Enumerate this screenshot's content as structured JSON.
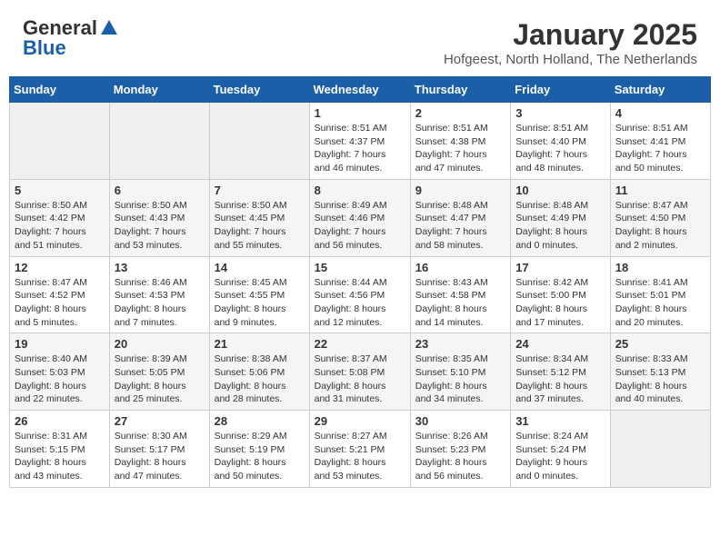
{
  "header": {
    "logo_general": "General",
    "logo_blue": "Blue",
    "month_year": "January 2025",
    "location": "Hofgeest, North Holland, The Netherlands"
  },
  "days_of_week": [
    "Sunday",
    "Monday",
    "Tuesday",
    "Wednesday",
    "Thursday",
    "Friday",
    "Saturday"
  ],
  "weeks": [
    [
      {
        "day": "",
        "info": ""
      },
      {
        "day": "",
        "info": ""
      },
      {
        "day": "",
        "info": ""
      },
      {
        "day": "1",
        "info": "Sunrise: 8:51 AM\nSunset: 4:37 PM\nDaylight: 7 hours and 46 minutes."
      },
      {
        "day": "2",
        "info": "Sunrise: 8:51 AM\nSunset: 4:38 PM\nDaylight: 7 hours and 47 minutes."
      },
      {
        "day": "3",
        "info": "Sunrise: 8:51 AM\nSunset: 4:40 PM\nDaylight: 7 hours and 48 minutes."
      },
      {
        "day": "4",
        "info": "Sunrise: 8:51 AM\nSunset: 4:41 PM\nDaylight: 7 hours and 50 minutes."
      }
    ],
    [
      {
        "day": "5",
        "info": "Sunrise: 8:50 AM\nSunset: 4:42 PM\nDaylight: 7 hours and 51 minutes."
      },
      {
        "day": "6",
        "info": "Sunrise: 8:50 AM\nSunset: 4:43 PM\nDaylight: 7 hours and 53 minutes."
      },
      {
        "day": "7",
        "info": "Sunrise: 8:50 AM\nSunset: 4:45 PM\nDaylight: 7 hours and 55 minutes."
      },
      {
        "day": "8",
        "info": "Sunrise: 8:49 AM\nSunset: 4:46 PM\nDaylight: 7 hours and 56 minutes."
      },
      {
        "day": "9",
        "info": "Sunrise: 8:48 AM\nSunset: 4:47 PM\nDaylight: 7 hours and 58 minutes."
      },
      {
        "day": "10",
        "info": "Sunrise: 8:48 AM\nSunset: 4:49 PM\nDaylight: 8 hours and 0 minutes."
      },
      {
        "day": "11",
        "info": "Sunrise: 8:47 AM\nSunset: 4:50 PM\nDaylight: 8 hours and 2 minutes."
      }
    ],
    [
      {
        "day": "12",
        "info": "Sunrise: 8:47 AM\nSunset: 4:52 PM\nDaylight: 8 hours and 5 minutes."
      },
      {
        "day": "13",
        "info": "Sunrise: 8:46 AM\nSunset: 4:53 PM\nDaylight: 8 hours and 7 minutes."
      },
      {
        "day": "14",
        "info": "Sunrise: 8:45 AM\nSunset: 4:55 PM\nDaylight: 8 hours and 9 minutes."
      },
      {
        "day": "15",
        "info": "Sunrise: 8:44 AM\nSunset: 4:56 PM\nDaylight: 8 hours and 12 minutes."
      },
      {
        "day": "16",
        "info": "Sunrise: 8:43 AM\nSunset: 4:58 PM\nDaylight: 8 hours and 14 minutes."
      },
      {
        "day": "17",
        "info": "Sunrise: 8:42 AM\nSunset: 5:00 PM\nDaylight: 8 hours and 17 minutes."
      },
      {
        "day": "18",
        "info": "Sunrise: 8:41 AM\nSunset: 5:01 PM\nDaylight: 8 hours and 20 minutes."
      }
    ],
    [
      {
        "day": "19",
        "info": "Sunrise: 8:40 AM\nSunset: 5:03 PM\nDaylight: 8 hours and 22 minutes."
      },
      {
        "day": "20",
        "info": "Sunrise: 8:39 AM\nSunset: 5:05 PM\nDaylight: 8 hours and 25 minutes."
      },
      {
        "day": "21",
        "info": "Sunrise: 8:38 AM\nSunset: 5:06 PM\nDaylight: 8 hours and 28 minutes."
      },
      {
        "day": "22",
        "info": "Sunrise: 8:37 AM\nSunset: 5:08 PM\nDaylight: 8 hours and 31 minutes."
      },
      {
        "day": "23",
        "info": "Sunrise: 8:35 AM\nSunset: 5:10 PM\nDaylight: 8 hours and 34 minutes."
      },
      {
        "day": "24",
        "info": "Sunrise: 8:34 AM\nSunset: 5:12 PM\nDaylight: 8 hours and 37 minutes."
      },
      {
        "day": "25",
        "info": "Sunrise: 8:33 AM\nSunset: 5:13 PM\nDaylight: 8 hours and 40 minutes."
      }
    ],
    [
      {
        "day": "26",
        "info": "Sunrise: 8:31 AM\nSunset: 5:15 PM\nDaylight: 8 hours and 43 minutes."
      },
      {
        "day": "27",
        "info": "Sunrise: 8:30 AM\nSunset: 5:17 PM\nDaylight: 8 hours and 47 minutes."
      },
      {
        "day": "28",
        "info": "Sunrise: 8:29 AM\nSunset: 5:19 PM\nDaylight: 8 hours and 50 minutes."
      },
      {
        "day": "29",
        "info": "Sunrise: 8:27 AM\nSunset: 5:21 PM\nDaylight: 8 hours and 53 minutes."
      },
      {
        "day": "30",
        "info": "Sunrise: 8:26 AM\nSunset: 5:23 PM\nDaylight: 8 hours and 56 minutes."
      },
      {
        "day": "31",
        "info": "Sunrise: 8:24 AM\nSunset: 5:24 PM\nDaylight: 9 hours and 0 minutes."
      },
      {
        "day": "",
        "info": ""
      }
    ]
  ]
}
